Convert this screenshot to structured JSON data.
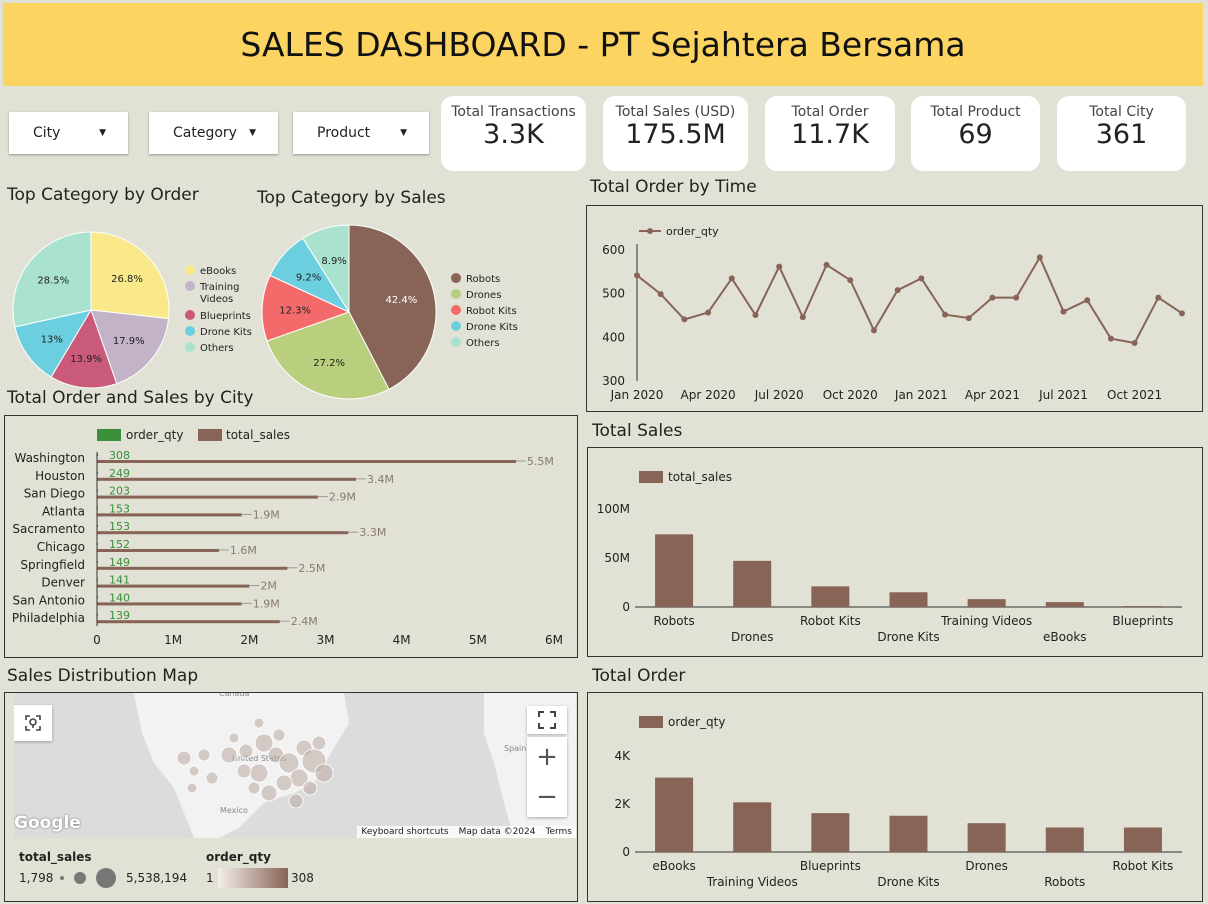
{
  "header": {
    "title": "SALES DASHBOARD - PT Sejahtera Bersama"
  },
  "filters": [
    {
      "label": "City"
    },
    {
      "label": "Category"
    },
    {
      "label": "Product"
    }
  ],
  "kpis": [
    {
      "title": "Total Transactions",
      "value": "3.3K"
    },
    {
      "title": "Total Sales (USD)",
      "value": "175.5M"
    },
    {
      "title": "Total Order",
      "value": "11.7K"
    },
    {
      "title": "Total Product",
      "value": "69"
    },
    {
      "title": "Total City",
      "value": "361"
    }
  ],
  "sections": {
    "pie_order": "Top Category by Order",
    "pie_sales": "Top Category by Sales",
    "time": "Total Order by Time",
    "city": "Total Order and Sales by City",
    "total_sales": "Total Sales",
    "total_order": "Total Order",
    "map": "Sales Distribution Map"
  },
  "colors": {
    "yellow": "#f9e98a",
    "lavender": "#c2b3c8",
    "rose": "#c95a7a",
    "cyan": "#6ccfdf",
    "mint": "#a9e3cf",
    "brown": "#876456",
    "olive": "#b9cf7d",
    "red": "#f46a6a",
    "green": "#3a8f3a"
  },
  "map": {
    "labels": [
      "Canada",
      "United States",
      "Mexico",
      "Spain"
    ],
    "google": "Google",
    "shortcuts": "Keyboard shortcuts",
    "mapdata": "Map data ©2024",
    "terms": "Terms",
    "legend_sales_title": "total_sales",
    "legend_sales_min": "1,798",
    "legend_sales_max": "5,538,194",
    "legend_order_title": "order_qty",
    "legend_order_min": "1",
    "legend_order_max": "308"
  },
  "chart_data": [
    {
      "id": "pie_order",
      "type": "pie",
      "slices": [
        {
          "label": "eBooks",
          "value": 26.8,
          "color": "#f9e98a"
        },
        {
          "label": "Training Videos",
          "value": 17.9,
          "color": "#c2b3c8"
        },
        {
          "label": "Blueprints",
          "value": 13.9,
          "color": "#c95a7a"
        },
        {
          "label": "Drone Kits",
          "value": 13.0,
          "color": "#6ccfdf"
        },
        {
          "label": "Others",
          "value": 28.5,
          "color": "#a9e3cf"
        }
      ],
      "slice_labels": [
        "26.8%",
        "17.9%",
        "13.9%",
        "13%",
        "28.5%"
      ]
    },
    {
      "id": "pie_sales",
      "type": "pie",
      "slices": [
        {
          "label": "Robots",
          "value": 42.4,
          "color": "#876456"
        },
        {
          "label": "Drones",
          "value": 27.2,
          "color": "#b9cf7d"
        },
        {
          "label": "Robot Kits",
          "value": 12.3,
          "color": "#f46a6a"
        },
        {
          "label": "Drone Kits",
          "value": 9.2,
          "color": "#6ccfdf"
        },
        {
          "label": "Others",
          "value": 8.9,
          "color": "#a9e3cf"
        }
      ],
      "slice_labels": [
        "42.4%",
        "27.2%",
        "12.3%",
        "9.2%",
        "8.9%"
      ]
    },
    {
      "id": "time",
      "type": "line",
      "series_name": "order_qty",
      "x": [
        "2020-01",
        "2020-02",
        "2020-03",
        "2020-04",
        "2020-05",
        "2020-06",
        "2020-07",
        "2020-08",
        "2020-09",
        "2020-10",
        "2020-11",
        "2020-12",
        "2021-01",
        "2021-02",
        "2021-03",
        "2021-04",
        "2021-05",
        "2021-06",
        "2021-07",
        "2021-08",
        "2021-09",
        "2021-10",
        "2021-11",
        "2021-12"
      ],
      "y": [
        542,
        499,
        441,
        457,
        535,
        451,
        562,
        446,
        566,
        531,
        416,
        508,
        535,
        452,
        444,
        491,
        491,
        583,
        459,
        485,
        397,
        387,
        491,
        455
      ],
      "ylim": [
        300,
        600
      ],
      "yticks": [
        "600",
        "500",
        "400",
        "300"
      ],
      "xticks": [
        "Jan 2020",
        "Apr 2020",
        "Jul 2020",
        "Oct 2020",
        "Jan 2021",
        "Apr 2021",
        "Jul 2021",
        "Oct 2021"
      ]
    },
    {
      "id": "city",
      "type": "bar",
      "orientation": "horizontal",
      "legend": [
        "order_qty",
        "total_sales"
      ],
      "categories": [
        "Washington",
        "Houston",
        "San Diego",
        "Atlanta",
        "Sacramento",
        "Chicago",
        "Springfield",
        "Denver",
        "San Antonio",
        "Philadelphia"
      ],
      "order_qty": [
        308,
        249,
        203,
        153,
        153,
        152,
        149,
        141,
        140,
        139
      ],
      "total_sales": [
        5.5,
        3.4,
        2.9,
        1.9,
        3.3,
        1.6,
        2.5,
        2.0,
        1.9,
        2.4
      ],
      "sales_labels": [
        "5.5M",
        "3.4M",
        "2.9M",
        "1.9M",
        "3.3M",
        "1.6M",
        "2.5M",
        "2M",
        "1.9M",
        "2.4M"
      ],
      "xlim": [
        0,
        6
      ],
      "xticks": [
        "0",
        "1M",
        "2M",
        "3M",
        "4M",
        "5M",
        "6M"
      ]
    },
    {
      "id": "total_sales",
      "type": "bar",
      "series_name": "total_sales",
      "categories": [
        "Robots",
        "Drones",
        "Robot Kits",
        "Drone Kits",
        "Training Videos",
        "eBooks",
        "Blueprints"
      ],
      "values": [
        74,
        47,
        21,
        15,
        8,
        5,
        1
      ],
      "ylim": [
        0,
        110
      ],
      "yticks": [
        "100M",
        "50M",
        "0"
      ]
    },
    {
      "id": "total_order",
      "type": "bar",
      "series_name": "order_qty",
      "categories": [
        "eBooks",
        "Training Videos",
        "Blueprints",
        "Drone Kits",
        "Drones",
        "Robots",
        "Robot Kits"
      ],
      "values": [
        3100,
        2070,
        1620,
        1510,
        1200,
        1020,
        1020
      ],
      "ylim": [
        0,
        4500
      ],
      "yticks": [
        "4K",
        "2K",
        "0"
      ]
    }
  ]
}
